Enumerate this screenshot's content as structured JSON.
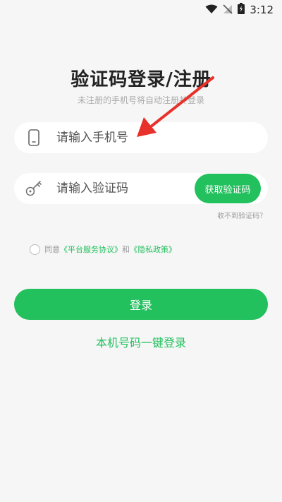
{
  "status_bar": {
    "time": "3:12"
  },
  "header": {
    "title": "验证码登录/注册",
    "subtitle": "未注册的手机号将自动注册并登录"
  },
  "phone": {
    "placeholder": "请输入手机号",
    "icon": "phone-icon"
  },
  "code": {
    "placeholder": "请输入验证码",
    "icon": "key-icon",
    "get_code_label": "获取验证码"
  },
  "no_code_label": "收不到验证码？",
  "agreement": {
    "prefix": "同意",
    "platform_link": "《平台服务协议》",
    "and": "和",
    "privacy_link": "《隐私政策》"
  },
  "login_label": "登录",
  "one_click_label": "本机号码一键登录",
  "colors": {
    "accent": "#23c05e",
    "annotation_arrow": "#e8312a"
  }
}
